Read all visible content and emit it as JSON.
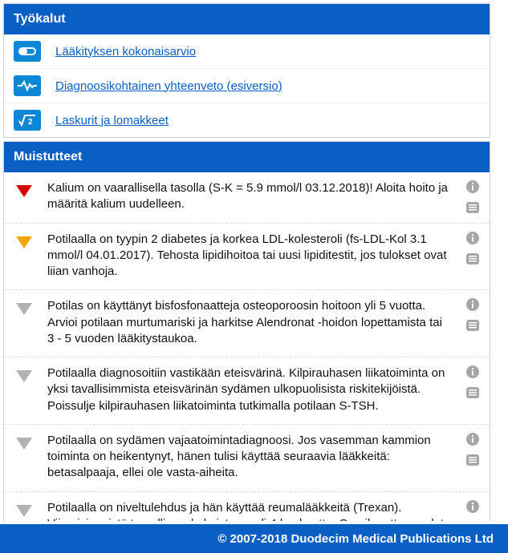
{
  "tools": {
    "header": "Työkalut",
    "items": [
      {
        "name": "pill-icon",
        "label": "Lääkityksen kokonaisarvio"
      },
      {
        "name": "wave-icon",
        "label": "Diagnoosikohtainen yhteenveto (esiversio)"
      },
      {
        "name": "sqrt-icon",
        "label": "Laskurit ja lomakkeet"
      }
    ]
  },
  "reminders": {
    "header": "Muistutteet",
    "items": [
      {
        "severity": "red",
        "text": "Kalium on vaarallisella tasolla (S-K = 5.9 mmol/l 03.12.2018)! Aloita hoito ja määritä kalium uudelleen."
      },
      {
        "severity": "orange",
        "text": "Potilaalla on tyypin 2 diabetes ja korkea LDL-kolesteroli (fs-LDL-Kol 3.1 mmol/l 04.01.2017). Tehosta lipidihoitoa tai uusi lipiditestit, jos tulokset ovat liian vanhoja."
      },
      {
        "severity": "grey",
        "text": "Potilas on käyttänyt bisfosfonaatteja osteoporoosin hoitoon yli 5 vuotta. Arvioi potilaan murtumariski ja harkitse Alendronat -hoidon lopettamista tai 3 - 5 vuoden lääkitystaukoa."
      },
      {
        "severity": "grey",
        "text": "Potilaalla diagnosoitiin vastikään eteisvärinä. Kilpirauhasen liikatoiminta on yksi tavallisimmista eteisvärinän sydämen ulkopuolisista riskitekijöistä. Poissulje kilpirauhasen liikatoiminta tutkimalla potilaan S-TSH."
      },
      {
        "severity": "grey",
        "text": "Potilaalla on sydämen vajaatoimintadiagnoosi. Jos vasemman kammion toiminta on heikentynyt, hänen tulisi käyttää seuraavia lääkkeitä: betasalpaaja, ellei ole vasta-aiheita."
      },
      {
        "severity": "grey",
        "text": "Potilaalla on niveltulehdus ja hän käyttää reumalääkkeitä (Trexan). Viimeisimmistä turvallisuuskokeista on yli 4 kuukautta. On aika ottaa uudet kokeet."
      }
    ]
  },
  "footer": "© 2007-2018 Duodecim Medical Publications Ltd",
  "colors": {
    "brand_blue": "#0a5fc5",
    "icon_blue": "#0a88d6",
    "severity_red": "#d50000",
    "severity_orange": "#f5a300",
    "severity_grey": "#b2b2b2"
  }
}
